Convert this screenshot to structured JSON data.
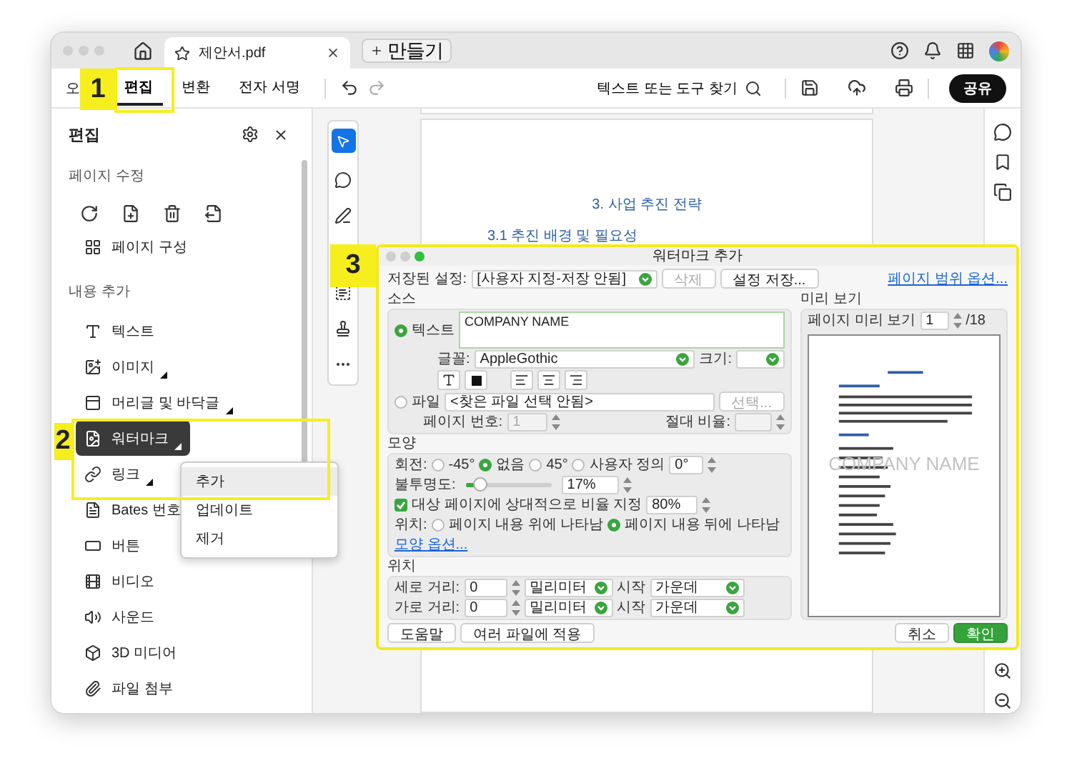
{
  "browser_tabs": {
    "tabs": [
      {
        "label": "제안서.pdf",
        "selected": true
      }
    ],
    "new_tab": "만들기"
  },
  "toolbar": {
    "partial_label": "오",
    "tabs": [
      {
        "label": "편집",
        "selected": true
      },
      {
        "label": "변환",
        "selected": false
      },
      {
        "label": "전자 서명",
        "selected": false
      }
    ],
    "search": "텍스트 또는 도구 찾기",
    "share": "공유"
  },
  "edit_panel": {
    "title": "편집",
    "page_edit_heading": "페이지 수정",
    "page_edit_item": "페이지 구성",
    "add_content_heading": "내용 추가",
    "items": [
      {
        "kind": "text",
        "label": "텍스트",
        "selected": false,
        "submenu": false
      },
      {
        "kind": "image",
        "label": "이미지",
        "selected": false,
        "submenu": true
      },
      {
        "kind": "header",
        "label": "머리글 및 바닥글",
        "selected": false,
        "submenu": true
      },
      {
        "kind": "watermark",
        "label": "워터마크",
        "selected": true,
        "submenu": true
      },
      {
        "kind": "link",
        "label": "링크",
        "selected": false,
        "submenu": true
      },
      {
        "kind": "bates",
        "label": "Bates 번호",
        "selected": false,
        "submenu": false
      },
      {
        "kind": "button",
        "label": "버튼",
        "selected": false,
        "submenu": false
      },
      {
        "kind": "video",
        "label": "비디오",
        "selected": false,
        "submenu": false
      },
      {
        "kind": "sound",
        "label": "사운드",
        "selected": false,
        "submenu": false
      },
      {
        "kind": "media",
        "label": "3D 미디어",
        "selected": false,
        "submenu": false
      },
      {
        "kind": "attach",
        "label": "파일 첨부",
        "selected": false,
        "submenu": false
      }
    ]
  },
  "context_menu": [
    {
      "label": "추가",
      "selected": true
    },
    {
      "label": "업데이트",
      "selected": false
    },
    {
      "label": "제거",
      "selected": false
    }
  ],
  "document": {
    "heading": "3. 사업 추진 전략",
    "subheading": "3.1 추진 배경 및 필요성"
  },
  "callouts": [
    {
      "label": "1"
    },
    {
      "label": "2"
    },
    {
      "label": "3"
    }
  ],
  "dialog": {
    "title": "워터마크 추가",
    "saved_label": "저장된 설정:",
    "saved_value": "[사용자 지정-저장 안됨]",
    "delete": {
      "label": "삭제",
      "disabled": true
    },
    "save_settings": "설정 저장...",
    "page_range_link": "페이지 범위 옵션...",
    "source": {
      "heading": "소스",
      "options": [
        {
          "label": "텍스트",
          "selected": true
        },
        {
          "label": "파일",
          "selected": false
        }
      ],
      "text_value": "COMPANY NAME",
      "font_label": "글꼴:",
      "font_value": "AppleGothic",
      "size_label": "크기:",
      "file_value": "<찾은 파일 선택 안됨>",
      "choose": {
        "label": "선택...",
        "disabled": true
      },
      "page_number_label": "페이지 번호:",
      "page_number": {
        "value": "1",
        "disabled": true
      },
      "scale_label": "절대 비율:"
    },
    "appearance": {
      "heading": "모양",
      "rotation_label": "회전:",
      "rotations": [
        {
          "label": "-45°",
          "selected": false
        },
        {
          "label": "없음",
          "selected": true
        },
        {
          "label": "45°",
          "selected": false
        },
        {
          "label": "사용자 정의",
          "selected": false
        }
      ],
      "rotation_value": "0°",
      "opacity_label": "불투명도:",
      "opacity": {
        "level": 0.17
      },
      "opacity_value": "17%",
      "relative_scale": {
        "label": "대상 페이지에 상대적으로 비율 지정",
        "checked": true
      },
      "scale_value": "80%",
      "location_label": "위치:",
      "locations": [
        {
          "label": "페이지 내용 위에 나타남",
          "selected": false
        },
        {
          "label": "페이지 내용 뒤에 나타남",
          "selected": true
        }
      ],
      "options_link": "모양 옵션..."
    },
    "position": {
      "heading": "위치",
      "rows": [
        {
          "label": "세로 거리:",
          "value": "0",
          "unit": "밀리미터",
          "from_label": "시작",
          "from_value": "가운데"
        },
        {
          "label": "가로 거리:",
          "value": "0",
          "unit": "밀리미터",
          "from_label": "시작",
          "from_value": "가운데"
        }
      ]
    },
    "preview": {
      "heading": "미리 보기",
      "page_label": "페이지 미리 보기",
      "page_value": "1",
      "page_total": "/18",
      "watermark": "COMPANY NAME"
    },
    "buttons": {
      "help": "도움말",
      "apply_multiple": "여러 파일에 적용",
      "cancel": "취소",
      "ok": "확인"
    }
  }
}
